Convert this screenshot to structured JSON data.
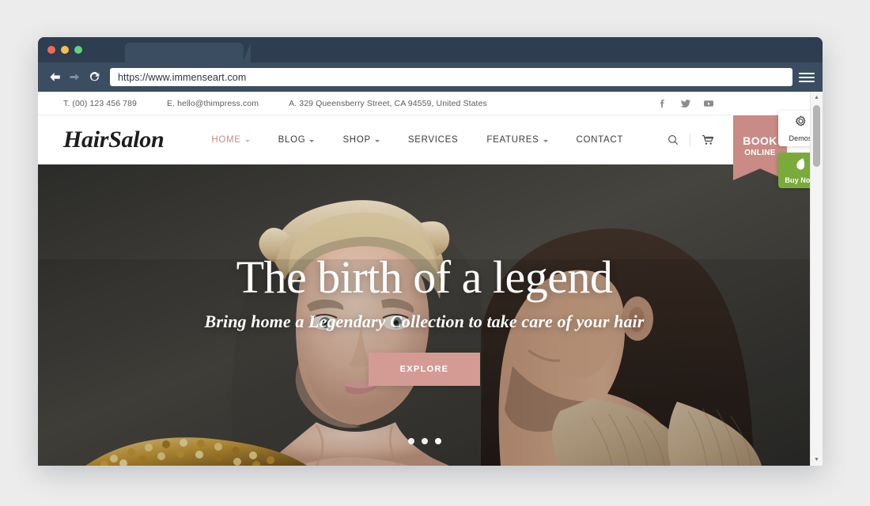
{
  "browser": {
    "url": "https://www.immenseart.com",
    "back_icon": "arrow-left-icon",
    "forward_icon": "arrow-right-icon",
    "reload_icon": "reload-icon",
    "menu_icon": "hamburger-menu-icon",
    "traffic_lights": [
      "close-red",
      "minimize-yellow",
      "maximize-green"
    ]
  },
  "site": {
    "topbar": {
      "phone": "T. (00) 123 456 789",
      "email": "E. hello@thimpress.com",
      "address": "A. 329 Queensberry Street, CA 94559, United States",
      "social": [
        {
          "name": "facebook-icon",
          "label": "f"
        },
        {
          "name": "twitter-icon",
          "label": "t"
        },
        {
          "name": "youtube-icon",
          "label": "y"
        }
      ]
    },
    "header": {
      "logo": "HairSalon",
      "nav": [
        {
          "label": "HOME",
          "active": true,
          "caret": true
        },
        {
          "label": "BLOG",
          "active": false,
          "caret": true
        },
        {
          "label": "SHOP",
          "active": false,
          "caret": true
        },
        {
          "label": "SERVICES",
          "active": false,
          "caret": false
        },
        {
          "label": "FEATURES",
          "active": false,
          "caret": true
        },
        {
          "label": "CONTACT",
          "active": false,
          "caret": false
        }
      ],
      "search_icon": "search-icon",
      "cart_icon": "shopping-cart-icon",
      "book_online_line1": "BOOK",
      "book_online_line2": "ONLINE"
    },
    "hero": {
      "title": "The birth of a legend",
      "subtitle": "Bring home a Legendary Collection to take care of your hair",
      "cta_label": "EXPLORE",
      "slides_total": 3,
      "slide_active": 3
    },
    "side_widgets": [
      {
        "name": "demos-widget",
        "label": "Demos",
        "icon": "gear-icon"
      },
      {
        "name": "buy-now-widget",
        "label": "Buy Now",
        "icon": "envato-leaf-icon"
      }
    ]
  },
  "colors": {
    "browser_chrome": "#3b4d61",
    "browser_titlebar": "#2e3e50",
    "accent_rose": "#c98b85",
    "cta_rose": "#d49b95",
    "buy_now_green": "#7aab3a",
    "page_background": "#ececec",
    "hero_backdrop": "#3a3a38"
  }
}
